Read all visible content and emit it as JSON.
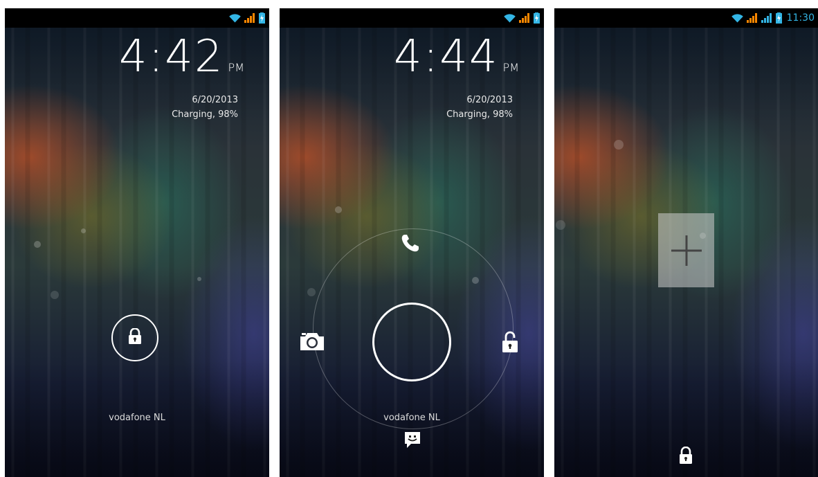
{
  "screens": [
    {
      "id": "lockscreen-locked",
      "clock": {
        "time": "4:42",
        "ampm": "PM"
      },
      "date": "6/20/2013",
      "charging": "Charging, 98%",
      "carrier": "vodafone NL",
      "icons": [
        "wifi-icon",
        "signal-icon",
        "battery-charging-icon",
        "lock-icon"
      ]
    },
    {
      "id": "lockscreen-unlock-targets",
      "clock": {
        "time": "4:44",
        "ampm": "PM"
      },
      "date": "6/20/2013",
      "charging": "Charging, 98%",
      "carrier": "vodafone NL",
      "icons": [
        "wifi-icon",
        "signal-icon",
        "battery-charging-icon",
        "phone-icon",
        "camera-icon",
        "unlock-icon",
        "messaging-icon"
      ]
    },
    {
      "id": "lockscreen-add-widget",
      "status_time": "11:30",
      "icons": [
        "wifi-icon",
        "signal-icon",
        "signal-icon",
        "battery-charging-icon",
        "add-widget-icon",
        "lock-icon"
      ]
    }
  ],
  "colors": {
    "wifi": "#33b5e5",
    "signal": "#ff8800",
    "status_time": "#33b5e5",
    "status_bar": "#000000",
    "ring": "#ffffff"
  }
}
